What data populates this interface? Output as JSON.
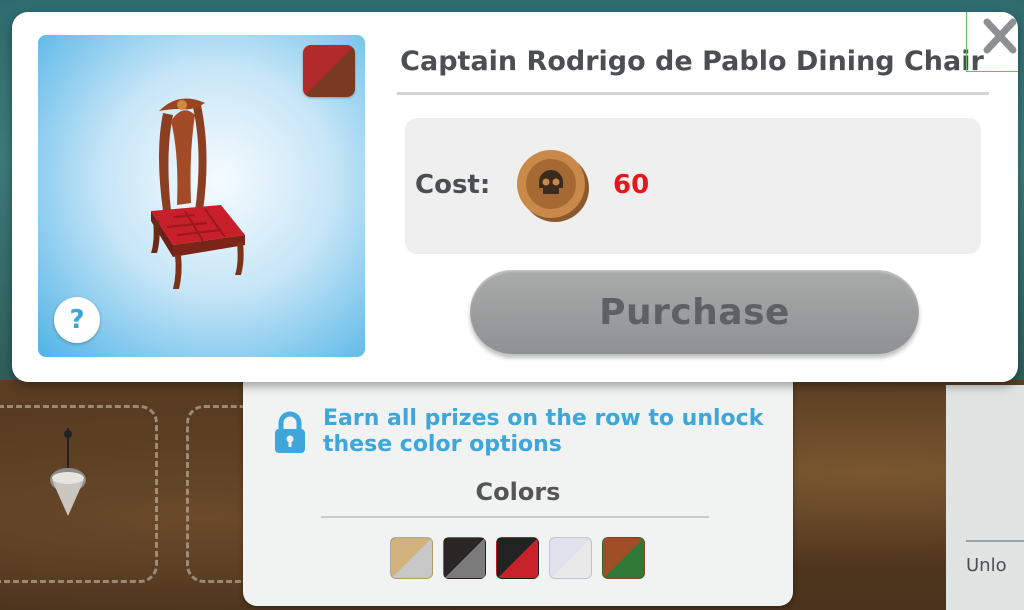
{
  "item": {
    "title": "Captain Rodrigo de Pablo Dining Chair",
    "cost_label": "Cost:",
    "cost_value": "60",
    "currency_icon": "skull-coin-icon",
    "purchase_label": "Purchase",
    "help_label": "?"
  },
  "colors": {
    "lock_message": "Earn all prizes on the row to unlock these color options",
    "title": "Colors",
    "swatches": [
      {
        "name": "tan",
        "top": "#d2b27c",
        "bottom": "#c7c7c7"
      },
      {
        "name": "black",
        "top": "#2b2524",
        "bottom": "#7c7c7c"
      },
      {
        "name": "red",
        "top": "#222222",
        "bottom": "#c8232a"
      },
      {
        "name": "white",
        "top": "#e2e2ef",
        "bottom": "#e9e9e9"
      },
      {
        "name": "green",
        "top": "#9e4f25",
        "bottom": "#2e7a36"
      }
    ]
  },
  "background": {
    "unlock_peek": "Unlo"
  },
  "theme": {
    "accent_blue": "#3ea6d8",
    "cost_red": "#e5171b",
    "disabled_button": "#9a9d9d"
  }
}
